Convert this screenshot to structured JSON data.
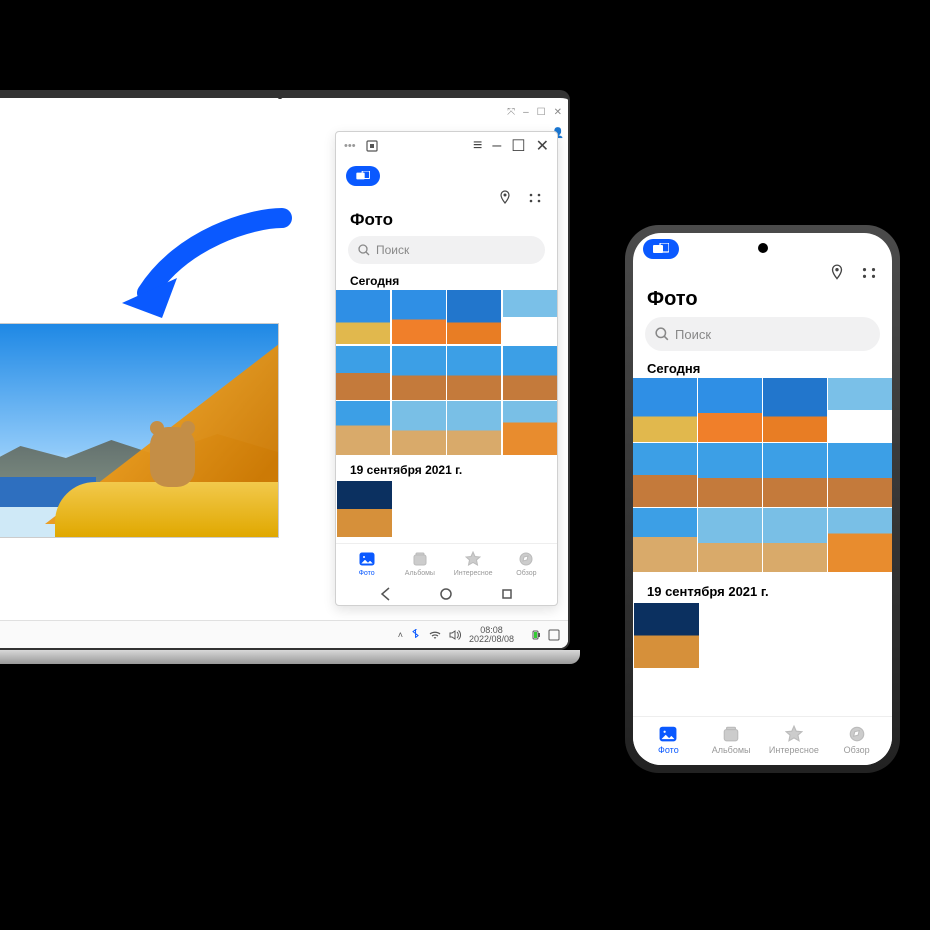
{
  "colors": {
    "accent": "#0a59ff"
  },
  "laptop": {
    "viewer": {
      "window_controls": [
        "–",
        "☐",
        "✕"
      ]
    },
    "mirror": {
      "titlebar_left": "•••",
      "controls": {
        "menu": "≡",
        "min": "–",
        "max": "☐",
        "close": "✕"
      }
    },
    "taskbar": {
      "time": "08:08",
      "date": "2022/08/08"
    }
  },
  "gallery": {
    "title": "Фото",
    "search_placeholder": "Поиск",
    "sections": {
      "today": "Сегодня",
      "sept21": "19 сентября 2021 г."
    },
    "tabs": {
      "photo": "Фото",
      "albums": "Альбомы",
      "highlights": "Интересное",
      "browse": "Обзор"
    }
  }
}
